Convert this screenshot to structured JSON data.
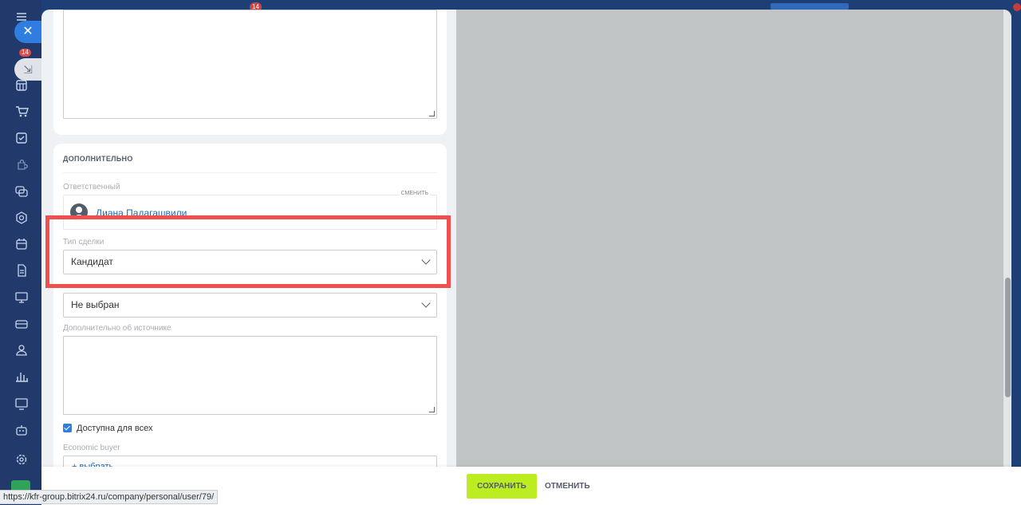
{
  "topbar": {
    "notifications_badge": "14"
  },
  "sidebar": {
    "badge": "14",
    "icons": [
      "menu-icon",
      "inbox-icon",
      "calendar-grid-icon",
      "cart-icon",
      "task-icon",
      "puzzle-icon",
      "chat-icon",
      "hexagon-icon",
      "calendar-icon",
      "document-icon",
      "presentation-icon",
      "card-icon",
      "users-icon",
      "chart-icon",
      "monitor-icon",
      "robot-icon",
      "gear-icon"
    ]
  },
  "card_top": {},
  "additional": {
    "title": "ДОПОЛНИТЕЛЬНО",
    "responsible_label": "Ответственный",
    "change_link": "СМЕНИТЬ",
    "responsible_name": "Диана Падагашвили",
    "deal_type_label": "Тип сделки",
    "deal_type_value": "Кандидат",
    "source_value": "Не выбран",
    "source_extra_label": "Дополнительно об источнике",
    "available_all_label": "Доступна для всех",
    "available_all_checked": true,
    "economic_buyer_label": "Economic buyer",
    "economic_buyer_link": "+ выбрать"
  },
  "footer": {
    "save_label": "СОХРАНИТЬ",
    "cancel_label": "ОТМЕНИТЬ"
  },
  "status_bar": {
    "url": "https://kfr-group.bitrix24.ru/company/personal/user/79/"
  },
  "colors": {
    "accent": "#2f7de0",
    "save": "#bbed21",
    "highlight": "#f04f4f",
    "link": "#2067b0"
  }
}
